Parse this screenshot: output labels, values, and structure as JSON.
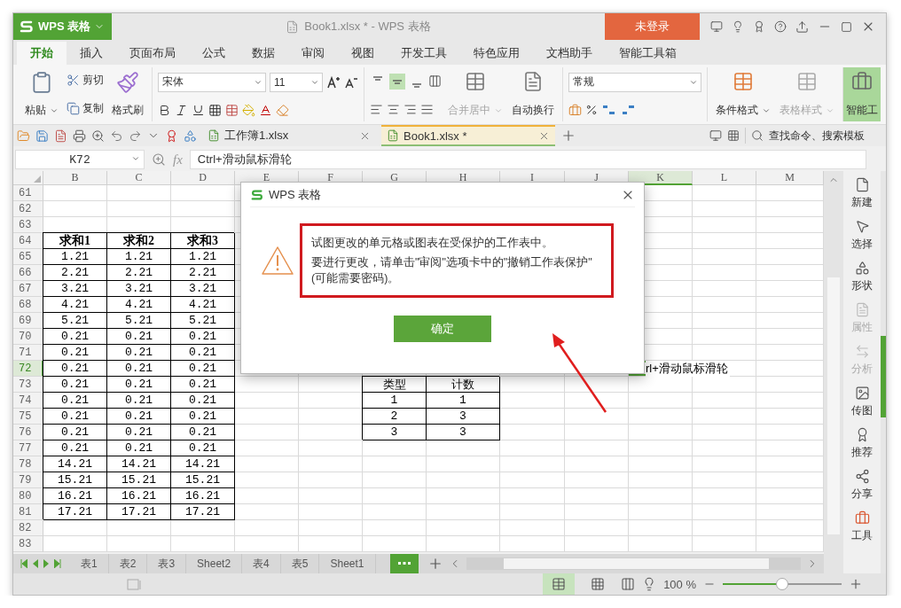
{
  "app_menu": {
    "label": "WPS 表格"
  },
  "window": {
    "title": "Book1.xlsx * - WPS 表格"
  },
  "account": {
    "label": "未登录"
  },
  "ribbon_tabs": [
    {
      "label": "开始",
      "selected": true
    },
    {
      "label": "插入",
      "selected": false
    },
    {
      "label": "页面布局",
      "selected": false
    },
    {
      "label": "公式",
      "selected": false
    },
    {
      "label": "数据",
      "selected": false
    },
    {
      "label": "审阅",
      "selected": false
    },
    {
      "label": "视图",
      "selected": false
    },
    {
      "label": "开发工具",
      "selected": false
    },
    {
      "label": "特色应用",
      "selected": false
    },
    {
      "label": "文档助手",
      "selected": false
    },
    {
      "label": "智能工具箱",
      "selected": false
    }
  ],
  "ribbon": {
    "clipboard": [
      {
        "label": "粘贴",
        "disabled": false
      },
      {
        "label": "剪切",
        "disabled": false
      },
      {
        "label": "复制",
        "disabled": false
      },
      {
        "label": "格式刷",
        "disabled": false
      }
    ],
    "font": {
      "name": "宋体",
      "size": "11"
    },
    "vertical_align": [
      {
        "selected": false
      },
      {
        "selected": true
      },
      {
        "selected": false
      }
    ],
    "cell_buttons": [
      {
        "label": "合并居中",
        "disabled": true
      },
      {
        "label": "自动换行",
        "disabled": false
      }
    ],
    "number_format": "常规",
    "style_buttons": [
      {
        "label": "条件格式",
        "disabled": false
      },
      {
        "label": "表格样式",
        "disabled": true
      }
    ],
    "tools_button": {
      "label": "智能工"
    }
  },
  "doc_tabs": [
    {
      "label": "工作簿1.xlsx",
      "selected": false
    },
    {
      "label": "Book1.xlsx *",
      "selected": true
    }
  ],
  "search": {
    "placeholder": "查找命令、搜索模板"
  },
  "formula_bar": {
    "cell": "K72",
    "fx": "fx",
    "formula": "Ctrl+滑动鼠标滑轮"
  },
  "sheet": {
    "columns": [
      {
        "label": "B",
        "selected": false
      },
      {
        "label": "C",
        "selected": false
      },
      {
        "label": "D",
        "selected": false
      },
      {
        "label": "E",
        "selected": false
      },
      {
        "label": "F",
        "selected": false
      },
      {
        "label": "G",
        "selected": false
      },
      {
        "label": "H",
        "selected": false
      },
      {
        "label": "I",
        "selected": false
      },
      {
        "label": "J",
        "selected": false
      },
      {
        "label": "K",
        "selected": true
      },
      {
        "label": "L",
        "selected": false
      },
      {
        "label": "M",
        "selected": false
      }
    ],
    "rows": [
      {
        "number": "61",
        "selected": false
      },
      {
        "number": "62",
        "selected": false
      },
      {
        "number": "63",
        "selected": false
      },
      {
        "number": "64",
        "selected": false,
        "cells": [
          {
            "kind": "header",
            "text": "求和1"
          },
          {
            "kind": "header",
            "text": "求和2"
          },
          {
            "kind": "header",
            "text": "求和3"
          }
        ]
      },
      {
        "number": "65",
        "selected": false,
        "cells": [
          {
            "kind": "value",
            "text": "1.21"
          },
          {
            "kind": "value",
            "text": "1.21"
          },
          {
            "kind": "value",
            "text": "1.21"
          }
        ]
      },
      {
        "number": "66",
        "selected": false,
        "cells": [
          {
            "kind": "value",
            "text": "2.21"
          },
          {
            "kind": "value",
            "text": "2.21"
          },
          {
            "kind": "value",
            "text": "2.21"
          }
        ]
      },
      {
        "number": "67",
        "selected": false,
        "cells": [
          {
            "kind": "value",
            "text": "3.21"
          },
          {
            "kind": "value",
            "text": "3.21"
          },
          {
            "kind": "value",
            "text": "3.21"
          }
        ]
      },
      {
        "number": "68",
        "selected": false,
        "cells": [
          {
            "kind": "value",
            "text": "4.21"
          },
          {
            "kind": "value",
            "text": "4.21"
          },
          {
            "kind": "value",
            "text": "4.21"
          }
        ]
      },
      {
        "number": "69",
        "selected": false,
        "cells": [
          {
            "kind": "value",
            "text": "5.21"
          },
          {
            "kind": "value",
            "text": "5.21"
          },
          {
            "kind": "value",
            "text": "5.21"
          }
        ]
      },
      {
        "number": "70",
        "selected": false,
        "cells": [
          {
            "kind": "value",
            "text": "0.21"
          },
          {
            "kind": "value",
            "text": "0.21"
          },
          {
            "kind": "value",
            "text": "0.21"
          }
        ]
      },
      {
        "number": "71",
        "selected": false,
        "cells": [
          {
            "kind": "value",
            "text": "0.21"
          },
          {
            "kind": "value",
            "text": "0.21"
          },
          {
            "kind": "value",
            "text": "0.21"
          }
        ]
      },
      {
        "number": "72",
        "selected": true,
        "cells": [
          {
            "kind": "value",
            "text": "0.21"
          },
          {
            "kind": "value",
            "text": "0.21"
          },
          {
            "kind": "value",
            "text": "0.21"
          },
          {
            "kind": "empty"
          },
          {
            "kind": "empty"
          },
          {
            "kind": "empty"
          },
          {
            "kind": "empty"
          },
          {
            "kind": "empty"
          },
          {
            "kind": "empty"
          },
          {
            "kind": "overflow",
            "text": "rl+滑动鼠标滑轮"
          }
        ]
      },
      {
        "number": "73",
        "selected": false,
        "cells": [
          {
            "kind": "value",
            "text": "0.21"
          },
          {
            "kind": "value",
            "text": "0.21"
          },
          {
            "kind": "value",
            "text": "0.21"
          },
          {
            "kind": "empty"
          },
          {
            "kind": "empty"
          },
          {
            "kind": "value",
            "text": "类型"
          },
          {
            "kind": "value",
            "text": "计数"
          }
        ]
      },
      {
        "number": "74",
        "selected": false,
        "cells": [
          {
            "kind": "value",
            "text": "0.21"
          },
          {
            "kind": "value",
            "text": "0.21"
          },
          {
            "kind": "value",
            "text": "0.21"
          },
          {
            "kind": "empty"
          },
          {
            "kind": "empty"
          },
          {
            "kind": "value",
            "text": "1"
          },
          {
            "kind": "value",
            "text": "1"
          }
        ]
      },
      {
        "number": "75",
        "selected": false,
        "cells": [
          {
            "kind": "value",
            "text": "0.21"
          },
          {
            "kind": "value",
            "text": "0.21"
          },
          {
            "kind": "value",
            "text": "0.21"
          },
          {
            "kind": "empty"
          },
          {
            "kind": "empty"
          },
          {
            "kind": "value",
            "text": "2"
          },
          {
            "kind": "value",
            "text": "3"
          }
        ]
      },
      {
        "number": "76",
        "selected": false,
        "cells": [
          {
            "kind": "value",
            "text": "0.21"
          },
          {
            "kind": "value",
            "text": "0.21"
          },
          {
            "kind": "value",
            "text": "0.21"
          },
          {
            "kind": "empty"
          },
          {
            "kind": "empty"
          },
          {
            "kind": "value",
            "text": "3"
          },
          {
            "kind": "value",
            "text": "3"
          }
        ]
      },
      {
        "number": "77",
        "selected": false,
        "cells": [
          {
            "kind": "value",
            "text": "0.21"
          },
          {
            "kind": "value",
            "text": "0.21"
          },
          {
            "kind": "value",
            "text": "0.21"
          }
        ]
      },
      {
        "number": "78",
        "selected": false,
        "cells": [
          {
            "kind": "value",
            "text": "14.21"
          },
          {
            "kind": "value",
            "text": "14.21"
          },
          {
            "kind": "value",
            "text": "14.21"
          }
        ]
      },
      {
        "number": "79",
        "selected": false,
        "cells": [
          {
            "kind": "value",
            "text": "15.21"
          },
          {
            "kind": "value",
            "text": "15.21"
          },
          {
            "kind": "value",
            "text": "15.21"
          }
        ]
      },
      {
        "number": "80",
        "selected": false,
        "cells": [
          {
            "kind": "value",
            "text": "16.21"
          },
          {
            "kind": "value",
            "text": "16.21"
          },
          {
            "kind": "value",
            "text": "16.21"
          }
        ]
      },
      {
        "number": "81",
        "selected": false,
        "cells": [
          {
            "kind": "value",
            "text": "17.21"
          },
          {
            "kind": "value",
            "text": "17.21"
          },
          {
            "kind": "value",
            "text": "17.21"
          }
        ]
      },
      {
        "number": "82",
        "selected": false
      },
      {
        "number": "83",
        "selected": false
      }
    ]
  },
  "sheet_tabs": [
    "表1",
    "表2",
    "表3",
    "Sheet2",
    "表4",
    "表5",
    "Sheet1"
  ],
  "sidebar": [
    {
      "label": "新建",
      "disabled": false
    },
    {
      "label": "选择",
      "disabled": false
    },
    {
      "label": "形状",
      "disabled": false
    },
    {
      "label": "属性",
      "disabled": true
    },
    {
      "label": "分析",
      "disabled": true
    },
    {
      "label": "传图",
      "disabled": false
    },
    {
      "label": "推荐",
      "disabled": false
    },
    {
      "label": "分享",
      "disabled": false
    },
    {
      "label": "工具",
      "disabled": false
    }
  ],
  "status_bar": {
    "view_modes": [
      {
        "kind": "normal",
        "selected": true
      },
      {
        "kind": "page_break",
        "selected": false
      }
    ],
    "zoom": "100 %",
    "zoom_slider": {
      "level": 0.5
    }
  },
  "dialog": {
    "title": "WPS 表格",
    "message": [
      "试图更改的单元格或图表在受保护的工作表中。",
      "要进行更改，请单击\"审阅\"选项卡中的\"撤销工作表保护\"(可能需要密码)。"
    ],
    "button": "确定"
  }
}
